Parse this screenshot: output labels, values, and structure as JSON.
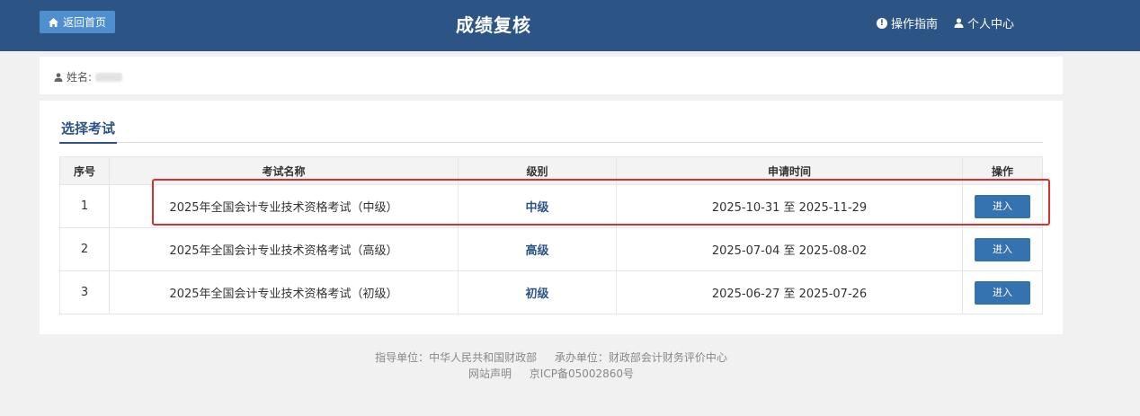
{
  "header": {
    "home_label": "返回首页",
    "title": "成绩复核",
    "guide_label": "操作指南",
    "profile_label": "个人中心",
    "bg_color": "#2c5585"
  },
  "user": {
    "name_label": "姓名:"
  },
  "section": {
    "title": "选择考试"
  },
  "table": {
    "headers": [
      "序号",
      "考试名称",
      "级别",
      "申请时间",
      "操作"
    ],
    "rows": [
      {
        "index": "1",
        "name": "2025年全国会计专业技术资格考试（中级）",
        "level": "中级",
        "period": "2025-10-31 至 2025-11-29",
        "action": "进入"
      },
      {
        "index": "2",
        "name": "2025年全国会计专业技术资格考试（高级）",
        "level": "高级",
        "period": "2025-07-04 至 2025-08-02",
        "action": "进入"
      },
      {
        "index": "3",
        "name": "2025年全国会计专业技术资格考试（初级）",
        "level": "初级",
        "period": "2025-06-27 至 2025-07-26",
        "action": "进入"
      }
    ]
  },
  "footer": {
    "guide_unit": "指导单位：中华人民共和国财政部",
    "host_unit": "承办单位：财政部会计财务评价中心",
    "site_statement": "网站声明",
    "icp": "京ICP备05002860号"
  },
  "icons": {
    "home": "home-icon",
    "info": "info-icon",
    "user": "user-icon"
  }
}
